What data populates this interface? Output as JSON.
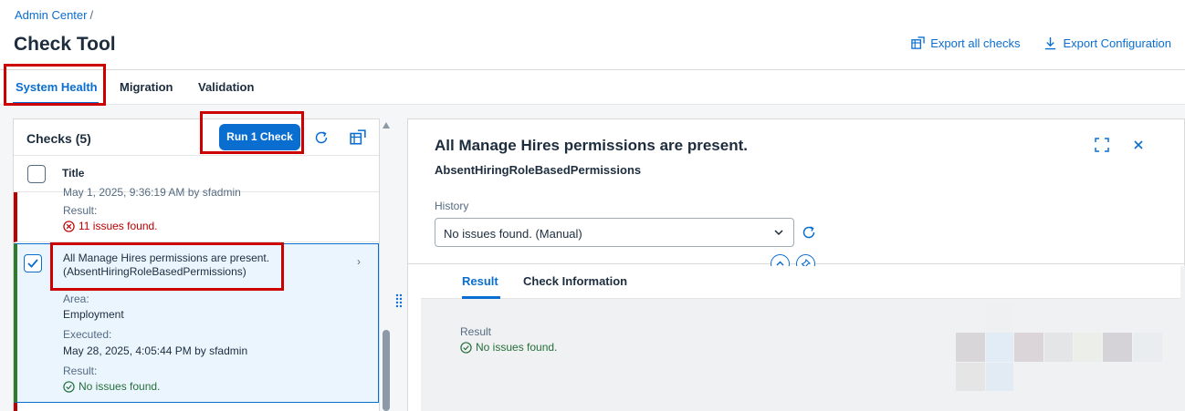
{
  "header": {
    "breadcrumb": "Admin Center",
    "breadcrumb_sep": "/",
    "title": "Check Tool",
    "actions": [
      {
        "label": "Export all checks",
        "icon": "export-table-icon"
      },
      {
        "label": "Export Configuration",
        "icon": "download-icon"
      }
    ]
  },
  "tabs": [
    "System Health",
    "Migration",
    "Validation"
  ],
  "active_tab": "System Health",
  "checks_panel": {
    "title": "Checks (5)",
    "run_button": "Run 1 Check",
    "column_title": "Title",
    "rows": [
      {
        "executed_partial": "May 1, 2025, 9:36:19 AM by sfadmin",
        "result_label": "Result:",
        "result": "11 issues found.",
        "status": "error"
      },
      {
        "title_line1": "All Manage Hires permissions are present.",
        "title_line2": "(AbsentHiringRoleBasedPermissions)",
        "area_label": "Area:",
        "area": "Employment",
        "executed_label": "Executed:",
        "executed": "May 28, 2025, 4:05:44 PM by sfadmin",
        "result_label": "Result:",
        "result": "No issues found.",
        "status": "success",
        "selected": true
      }
    ]
  },
  "detail": {
    "title": "All Manage Hires permissions are present.",
    "subtitle": "AbsentHiringRoleBasedPermissions",
    "history_label": "History",
    "history_value": "No issues found. (Manual)",
    "sub_tabs": [
      "Result",
      "Check Information"
    ],
    "active_sub_tab": "Result",
    "result_label": "Result",
    "result_value": "No issues found."
  },
  "colors": {
    "accent": "#0a6ed1",
    "error": "#bb0000",
    "success": "#256f3a",
    "highlight": "#cc0000"
  }
}
